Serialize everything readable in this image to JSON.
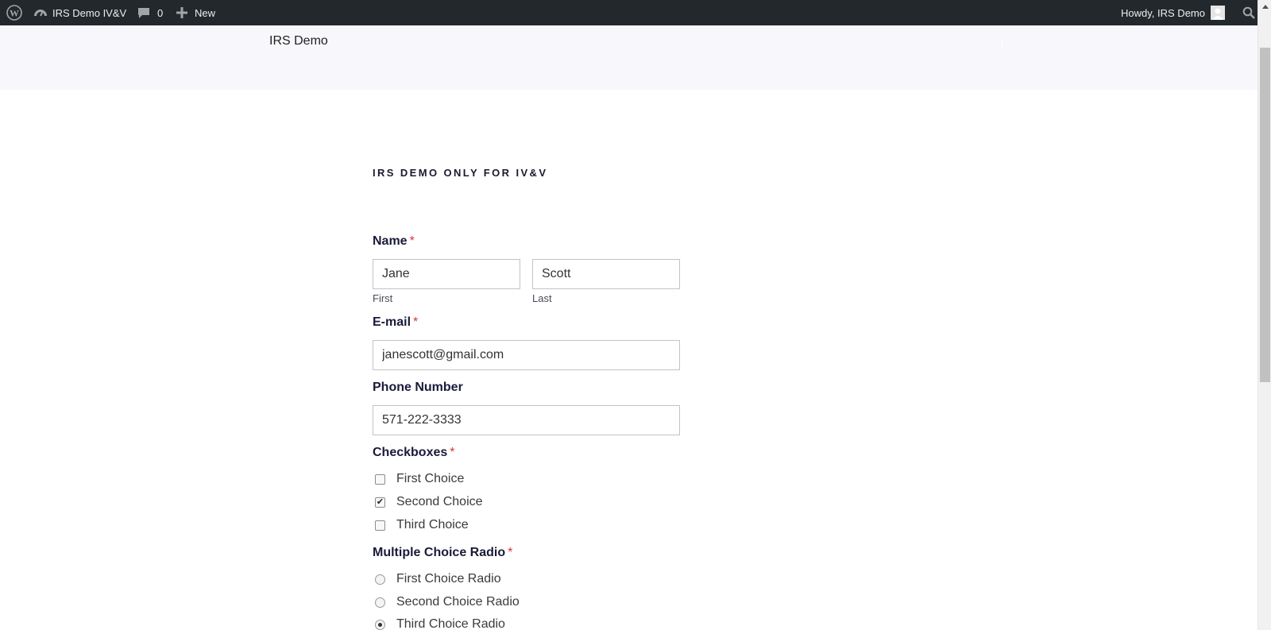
{
  "admin_bar": {
    "site_name": "IRS Demo IV&V",
    "comment_count": "0",
    "new_label": "New",
    "howdy": "Howdy, IRS Demo"
  },
  "header": {
    "site_title": "IRS Demo"
  },
  "page": {
    "title": "IRS DEMO ONLY FOR IV&V"
  },
  "form": {
    "name": {
      "label": "Name",
      "required_mark": "*",
      "first_value": "Jane",
      "last_value": "Scott",
      "first_sublabel": "First",
      "last_sublabel": "Last"
    },
    "email": {
      "label": "E-mail",
      "required_mark": "*",
      "value": "janescott@gmail.com"
    },
    "phone": {
      "label": "Phone Number",
      "value": "571-222-3333"
    },
    "checkboxes": {
      "label": "Checkboxes",
      "required_mark": "*",
      "options": [
        {
          "label": "First Choice",
          "checked": false
        },
        {
          "label": "Second Choice",
          "checked": true
        },
        {
          "label": "Third Choice",
          "checked": false
        }
      ]
    },
    "radio": {
      "label": "Multiple Choice Radio",
      "required_mark": "*",
      "options": [
        {
          "label": "First Choice Radio",
          "selected": false
        },
        {
          "label": "Second Choice Radio",
          "selected": false
        },
        {
          "label": "Third Choice Radio",
          "selected": true
        }
      ]
    }
  },
  "colors": {
    "admin_bar_bg": "#23282d",
    "header_bg": "#f8f8fc",
    "required": "#d63638"
  }
}
